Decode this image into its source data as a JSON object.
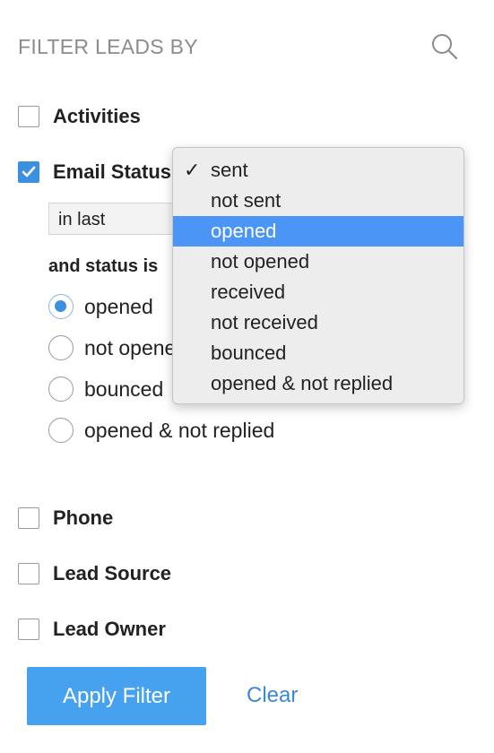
{
  "header": {
    "title": "FILTER LEADS BY",
    "search_icon": "search-icon"
  },
  "filters": {
    "activities": {
      "label": "Activities",
      "checked": false
    },
    "email_status": {
      "label": "Email Status",
      "checked": true,
      "period_select": "in last",
      "status_heading": "and status is",
      "options": [
        "opened",
        "not opened",
        "bounced",
        "opened & not replied"
      ],
      "selected_option": "opened"
    },
    "phone": {
      "label": "Phone",
      "checked": false
    },
    "lead_source": {
      "label": "Lead Source",
      "checked": false
    },
    "lead_owner": {
      "label": "Lead Owner",
      "checked": false
    }
  },
  "dropdown": {
    "items": [
      "sent",
      "not sent",
      "opened",
      "not opened",
      "received",
      "not received",
      "bounced",
      "opened & not replied"
    ],
    "checked_item": "sent",
    "checkmark": "✓",
    "highlighted_item": "opened"
  },
  "actions": {
    "apply_label": "Apply Filter",
    "clear_label": "Clear"
  },
  "colors": {
    "accent": "#3d8fe0",
    "button": "#46a1ef",
    "link": "#3a88d6",
    "highlight": "#4a95f5",
    "header_text": "#8c8c8c"
  }
}
